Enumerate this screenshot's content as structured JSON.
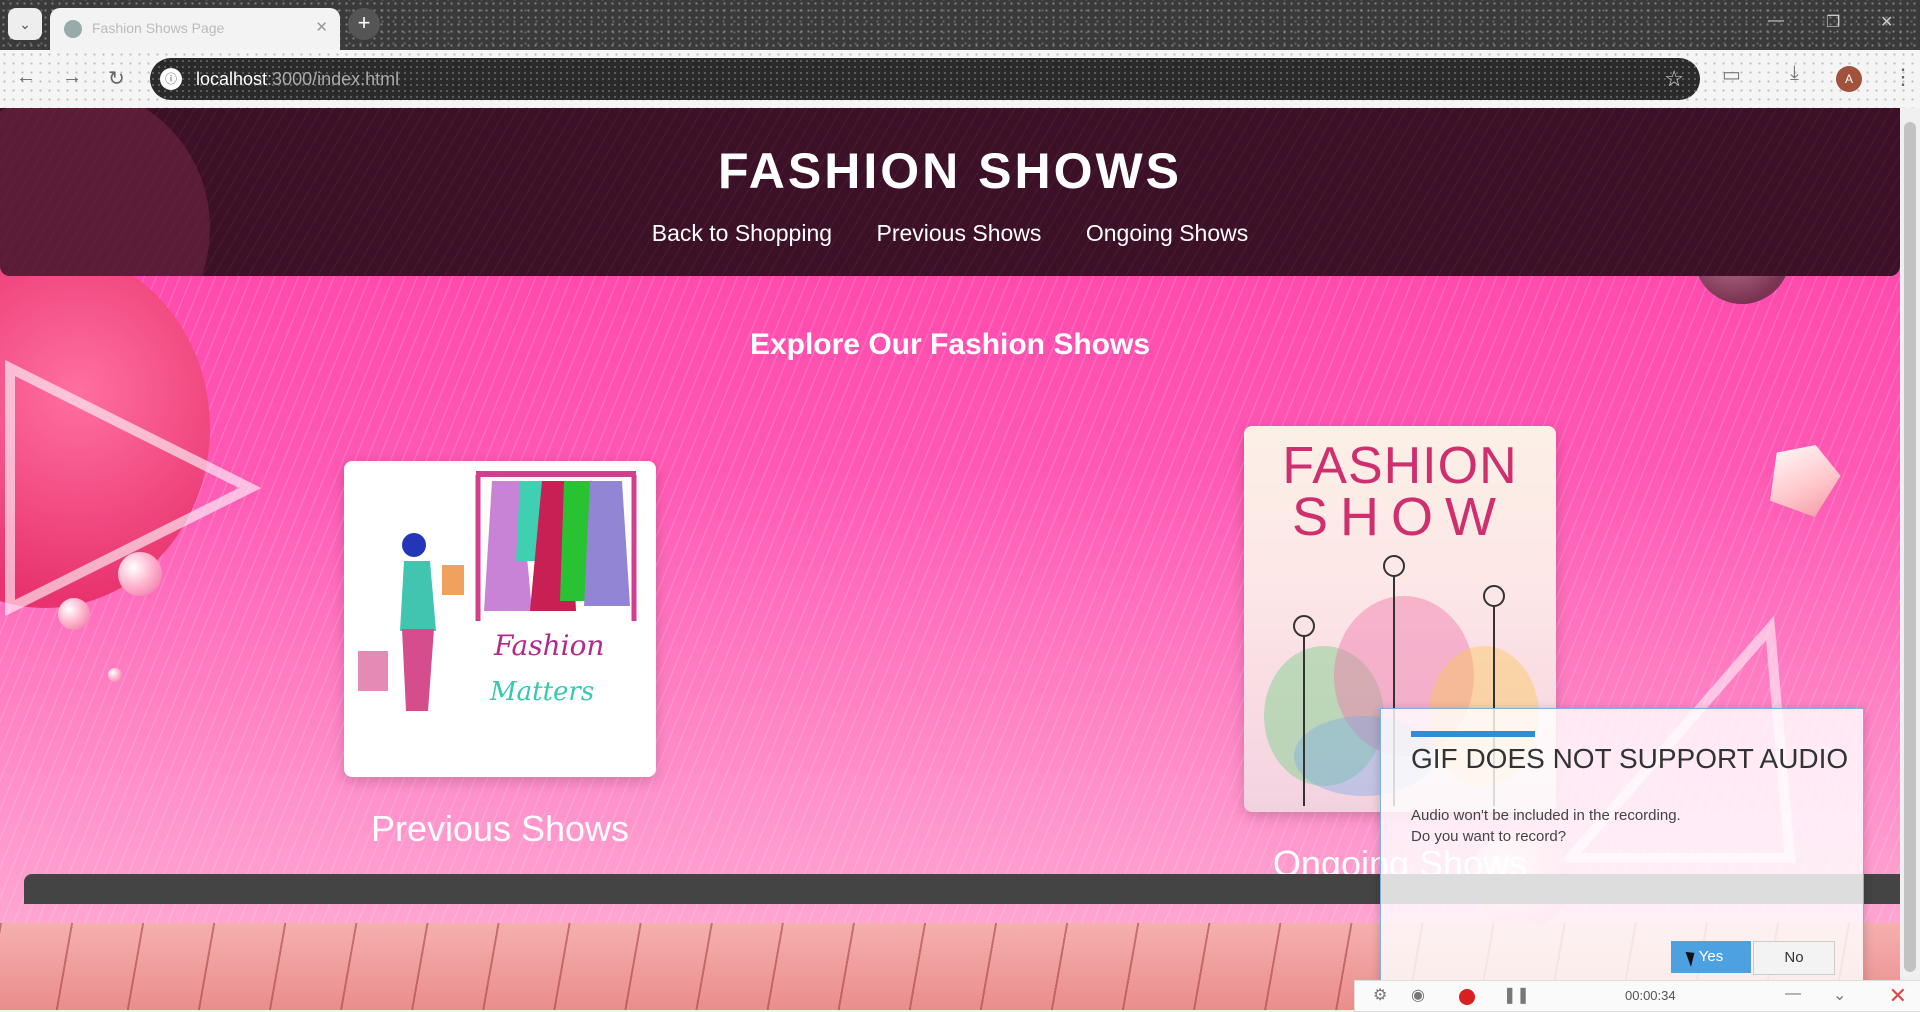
{
  "browser": {
    "tab_title": "Fashion Shows Page",
    "tab_close": "✕",
    "new_tab": "+",
    "url_host": "localhost",
    "url_path": ":3000/index.html",
    "profile_initial": "A",
    "window_controls": [
      "—",
      "❐",
      "✕"
    ]
  },
  "site": {
    "title": "FASHION SHOWS",
    "nav": [
      "Back to Shopping",
      "Previous Shows",
      "Ongoing Shows"
    ],
    "explore_heading": "Explore Our Fashion Shows",
    "cards": [
      {
        "label": "Previous Shows",
        "image_text_1": "Fashion",
        "image_text_2": "Matters"
      },
      {
        "label": "Ongoing Shows",
        "image_text_1": "FASHION",
        "image_text_2": "SHOW"
      }
    ]
  },
  "dialog": {
    "title": "GIF DOES NOT SUPPORT AUDIO",
    "line1": "Audio won't be included in the recording.",
    "line2": "Do you want to record?",
    "yes": "Yes",
    "no": "No"
  },
  "recorder": {
    "timer": "00:00:34",
    "close": "✕"
  },
  "colors": {
    "banner": "#3c1026",
    "page_pink": "#ff4faf",
    "dialog_accent": "#2d8fd6"
  }
}
